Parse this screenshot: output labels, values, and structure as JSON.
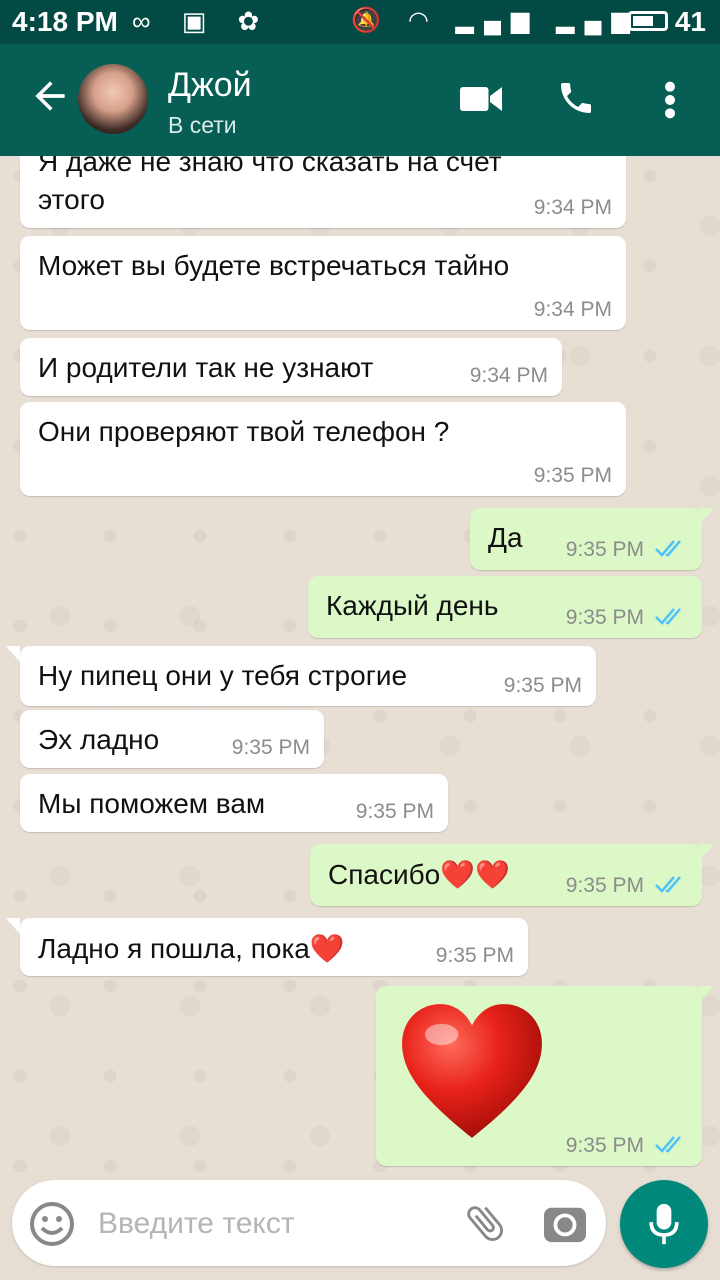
{
  "status_bar": {
    "time": "4:18 PM",
    "left_icons": "∞ ▣ ✿",
    "right_icons": "🔕 ◠ ▂▄▆ ▂▄▆",
    "battery_level": "41"
  },
  "header": {
    "contact_name": "Джой",
    "contact_status": "В сети"
  },
  "messages": [
    {
      "text": "Я даже не знаю что сказать на счет",
      "text2": "этого",
      "time": "9:34 PM",
      "dir": "in"
    },
    {
      "text": "Может вы будете встречаться тайно",
      "time": "9:34 PM",
      "dir": "in"
    },
    {
      "text": "И родители так не узнают",
      "time": "9:34 PM",
      "dir": "in"
    },
    {
      "text": "Они проверяют твой телефон ?",
      "time": "9:35 PM",
      "dir": "in"
    },
    {
      "text": "Да",
      "time": "9:35 PM",
      "dir": "out"
    },
    {
      "text": "Каждый день",
      "time": "9:35 PM",
      "dir": "out"
    },
    {
      "text": "Ну пипец они у тебя строгие",
      "time": "9:35 PM",
      "dir": "in"
    },
    {
      "text": "Эх ладно",
      "time": "9:35 PM",
      "dir": "in"
    },
    {
      "text": "Мы поможем вам",
      "time": "9:35 PM",
      "dir": "in"
    },
    {
      "text": "Спасибо❤️❤️",
      "time": "9:35 PM",
      "dir": "out"
    },
    {
      "text": "Ладно я пошла, пока❤️",
      "time": "9:35 PM",
      "dir": "in"
    },
    {
      "text": "",
      "time": "9:35 PM",
      "dir": "out"
    }
  ],
  "input": {
    "placeholder": "Введите текст"
  },
  "colors": {
    "header": "#075e54",
    "status_bar": "#044a44",
    "incoming_bubble": "#ffffff",
    "outgoing_bubble": "#dcf8c6",
    "read_ticks": "#4fc3f7",
    "mic_button": "#00897b"
  },
  "icons": [
    "back-arrow-icon",
    "video-call-icon",
    "phone-icon",
    "more-vert-icon",
    "emoji-icon",
    "paperclip-icon",
    "camera-icon",
    "mic-icon",
    "double-check-icon",
    "heart-sticker-icon"
  ]
}
